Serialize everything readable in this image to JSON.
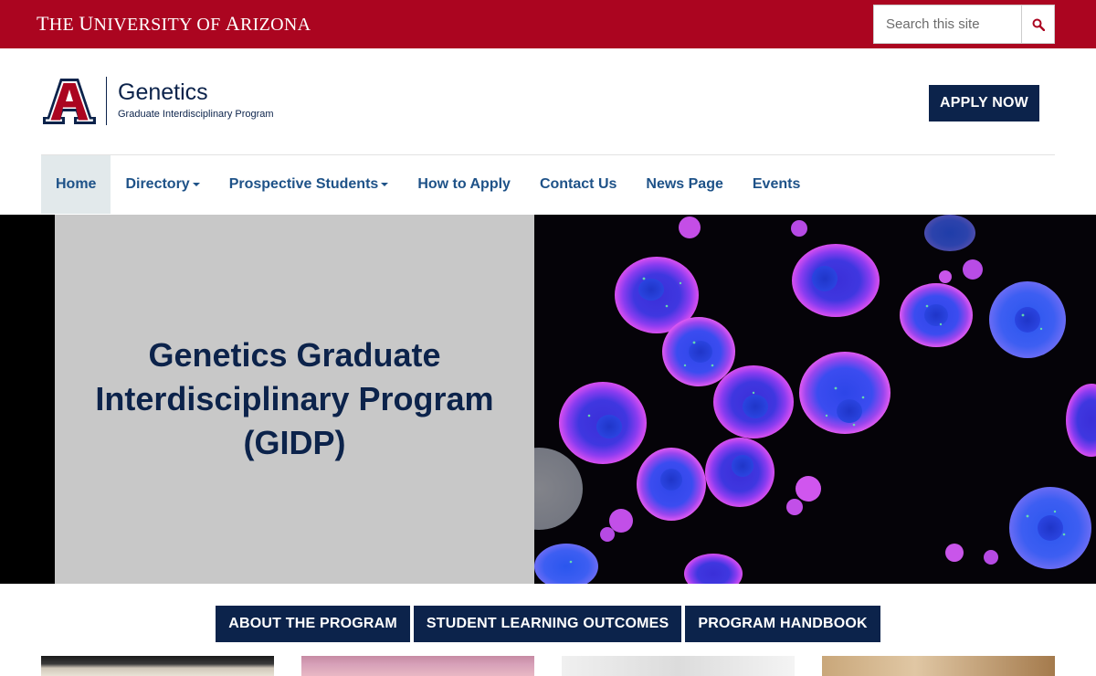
{
  "top_bar": {
    "wordmark": {
      "the": "T",
      "the_rest": "HE ",
      "university_u": "U",
      "university_rest": "NIVERSITY ",
      "of": "OF ",
      "arizona_a": "A",
      "arizona_rest": "RIZONA"
    },
    "search": {
      "placeholder": "Search this site",
      "icon": "search-icon"
    }
  },
  "header": {
    "logo_icon": "block-a-logo",
    "site_title": "Genetics",
    "site_subtitle": "Graduate Interdisciplinary Program",
    "apply_label": "APPLY NOW"
  },
  "nav": {
    "items": [
      {
        "label": "Home",
        "active": true,
        "dropdown": false
      },
      {
        "label": "Directory",
        "active": false,
        "dropdown": true
      },
      {
        "label": "Prospective Students",
        "active": false,
        "dropdown": true
      },
      {
        "label": "How to Apply",
        "active": false,
        "dropdown": false
      },
      {
        "label": "Contact Us",
        "active": false,
        "dropdown": false
      },
      {
        "label": "News Page",
        "active": false,
        "dropdown": false
      },
      {
        "label": "Events",
        "active": false,
        "dropdown": false
      }
    ]
  },
  "hero": {
    "title": "Genetics Graduate Interdisciplinary Program (GIDP)"
  },
  "buttons": {
    "about": "ABOUT THE PROGRAM",
    "outcomes": "STUDENT LEARNING OUTCOMES",
    "handbook": "PROGRAM HANDBOOK"
  },
  "colors": {
    "brand_red": "#ab0520",
    "brand_navy": "#0c234b",
    "nav_blue": "#1e5288"
  }
}
